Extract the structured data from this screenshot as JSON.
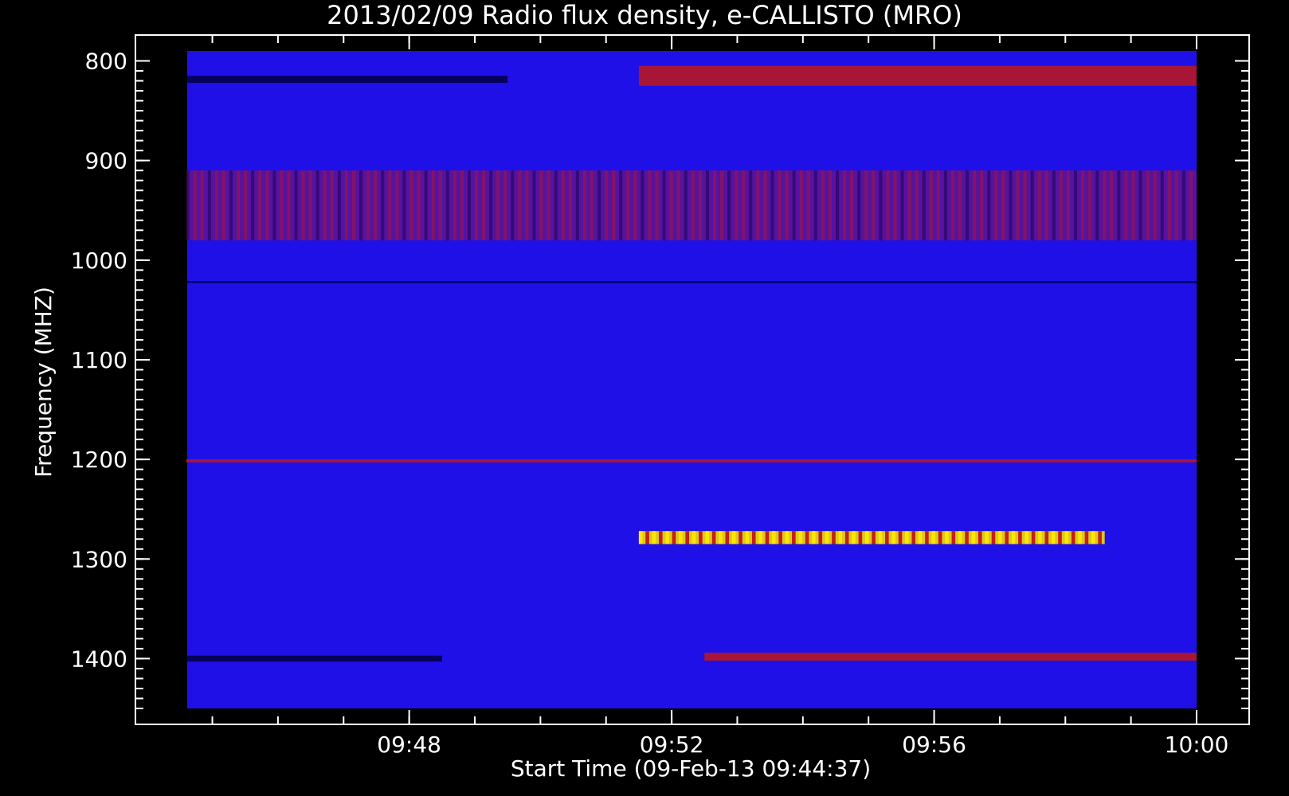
{
  "chart_data": {
    "type": "heatmap",
    "title": "2013/02/09  Radio flux density, e-CALLISTO (MRO)",
    "xlabel": "Start Time (09-Feb-13 09:44:37)",
    "ylabel": "Frequency (MHZ)",
    "x_ticks": [
      "09:48",
      "09:52",
      "09:56",
      "10:00"
    ],
    "x_tick_minutes": [
      228,
      232,
      236,
      240
    ],
    "y_ticks": [
      800,
      900,
      1000,
      1100,
      1200,
      1300,
      1400
    ],
    "xlim_minutes": [
      224.617,
      240.0
    ],
    "ylim_mhz": [
      1450,
      790
    ],
    "colormap": {
      "background": "#2010e8",
      "low": "#000040",
      "mid": "#c01818",
      "high": "#ffffff",
      "burst": "#ffe800"
    },
    "features": [
      {
        "name": "upper red band",
        "freq_mhz": [
          805,
          825
        ],
        "time_minutes": [
          231.5,
          240.0
        ],
        "level": "medium"
      },
      {
        "name": "dark band",
        "freq_mhz": [
          815,
          822
        ],
        "time_minutes": [
          224.6,
          229.5
        ],
        "level": "low"
      },
      {
        "name": "vertical striping",
        "freq_mhz": [
          910,
          980
        ],
        "time_minutes": [
          224.6,
          240.0
        ],
        "level": "mixed"
      },
      {
        "name": "dark line",
        "freq_mhz": [
          1021,
          1023
        ],
        "time_minutes": [
          224.6,
          240.0
        ],
        "level": "low"
      },
      {
        "name": "red line",
        "freq_mhz": [
          1200,
          1203
        ],
        "time_minutes": [
          224.6,
          240.0
        ],
        "level": "medium"
      },
      {
        "name": "burst band",
        "freq_mhz": [
          1272,
          1285
        ],
        "time_minutes": [
          231.5,
          238.6
        ],
        "level": "high"
      },
      {
        "name": "lower red band",
        "freq_mhz": [
          1394,
          1402
        ],
        "time_minutes": [
          232.5,
          240.0
        ],
        "level": "medium"
      },
      {
        "name": "dark band 1400",
        "freq_mhz": [
          1397,
          1403
        ],
        "time_minutes": [
          224.6,
          228.5
        ],
        "level": "low"
      }
    ]
  }
}
